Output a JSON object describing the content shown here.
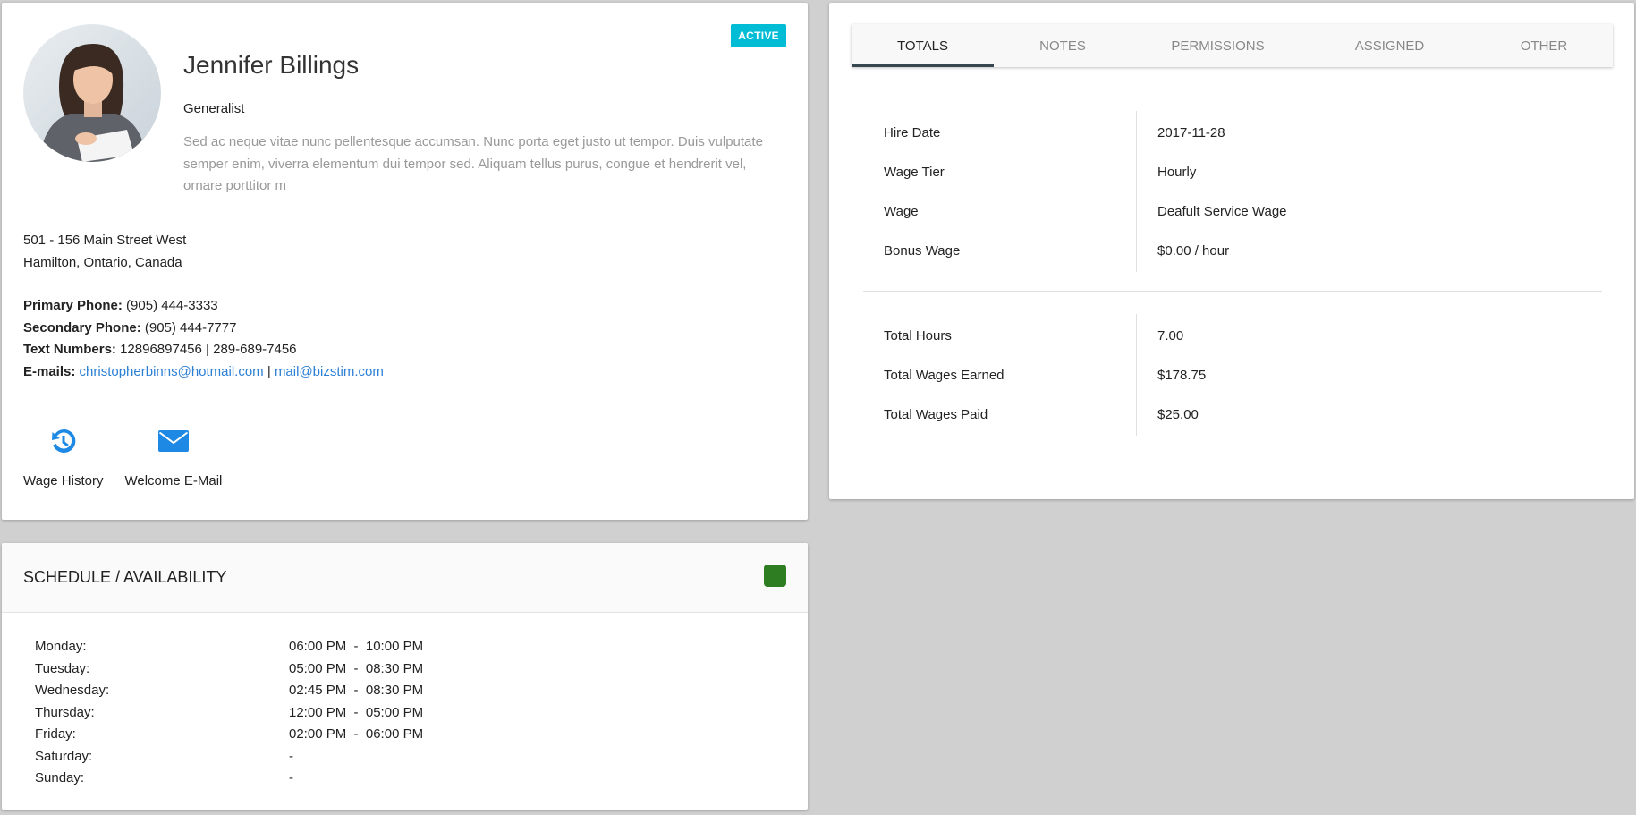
{
  "profile": {
    "name": "Jennifer Billings",
    "role": "Generalist",
    "status": "ACTIVE",
    "status_color": "#00bcd4",
    "bio": "Sed ac neque vitae nunc pellentesque accumsan. Nunc porta eget justo ut tempor. Duis vulputate semper enim, viverra elementum dui tempor sed. Aliquam tellus purus, congue et hendrerit vel, ornare porttitor m",
    "address_line1": "501 - 156 Main Street West",
    "address_line2": "Hamilton, Ontario, Canada",
    "contacts": {
      "primary_phone_label": "Primary Phone:",
      "primary_phone": "(905) 444-3333",
      "secondary_phone_label": "Secondary Phone:",
      "secondary_phone": "(905) 444-7777",
      "text_numbers_label": "Text Numbers:",
      "text_number_1": "12896897456",
      "text_separator": "|",
      "text_number_2": "289-689-7456",
      "emails_label": "E-mails:",
      "email_1": "christopherbinns@hotmail.com",
      "email_separator": "|",
      "email_2": "mail@bizstim.com",
      "link_color": "#2b7fd4"
    },
    "actions": [
      {
        "label": "Wage History",
        "icon": "history-icon"
      },
      {
        "label": "Welcome E-Mail",
        "icon": "envelope-icon"
      }
    ],
    "icon_color": "#1e88e5"
  },
  "schedule": {
    "title": "SCHEDULE / AVAILABILITY",
    "toggle_color": "#2e7d22",
    "rows": [
      {
        "day": "Monday:",
        "hours": "06:00 PM  -  10:00 PM"
      },
      {
        "day": "Tuesday:",
        "hours": "05:00 PM  -  08:30 PM"
      },
      {
        "day": "Wednesday:",
        "hours": "02:45 PM  -  08:30 PM"
      },
      {
        "day": "Thursday:",
        "hours": "12:00 PM  -  05:00 PM"
      },
      {
        "day": "Friday:",
        "hours": "02:00 PM  -  06:00 PM"
      },
      {
        "day": "Saturday:",
        "hours": "-"
      },
      {
        "day": "Sunday:",
        "hours": "-"
      }
    ]
  },
  "details": {
    "tabs": [
      {
        "label": "TOTALS",
        "active": true
      },
      {
        "label": "NOTES",
        "active": false
      },
      {
        "label": "PERMISSIONS",
        "active": false
      },
      {
        "label": "ASSIGNED",
        "active": false
      },
      {
        "label": "OTHER",
        "active": false
      }
    ],
    "wage_info": [
      {
        "label": "Hire Date",
        "value": "2017-11-28"
      },
      {
        "label": "Wage Tier",
        "value": "Hourly"
      },
      {
        "label": "Wage",
        "value": "Deafult Service Wage"
      },
      {
        "label": "Bonus Wage",
        "value": "$0.00 / hour"
      }
    ],
    "totals": [
      {
        "label": "Total Hours",
        "value": "7.00"
      },
      {
        "label": "Total Wages Earned",
        "value": "$178.75"
      },
      {
        "label": "Total Wages Paid",
        "value": "$25.00"
      }
    ]
  }
}
